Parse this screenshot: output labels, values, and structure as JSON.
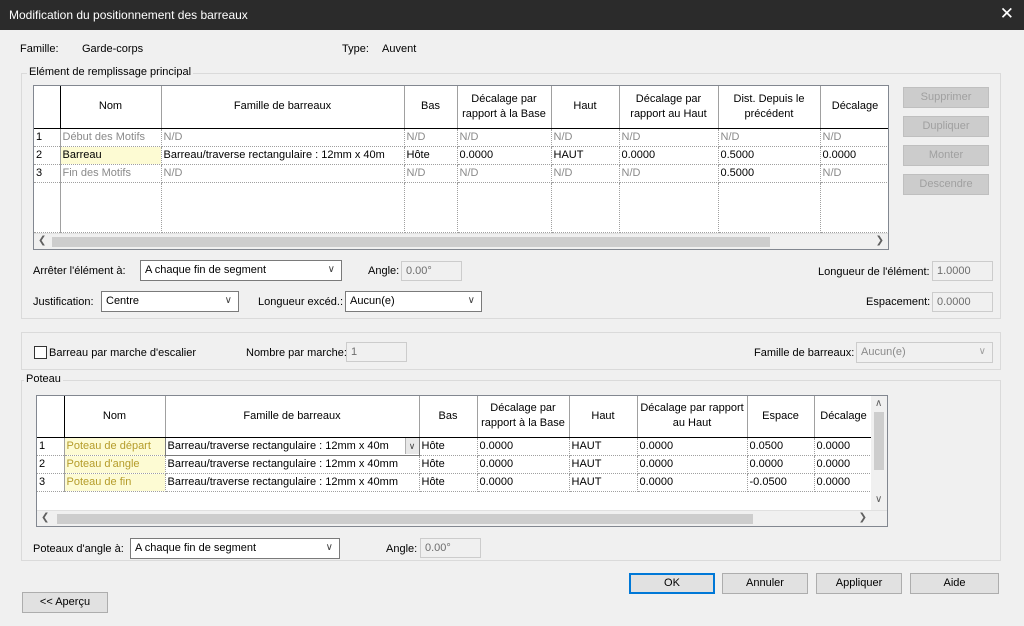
{
  "window": {
    "title": "Modification du positionnement des barreaux",
    "close": "✕"
  },
  "header": {
    "family_label": "Famille:",
    "family_value": "Garde-corps",
    "type_label": "Type:",
    "type_value": "Auvent"
  },
  "main_group": {
    "title": "Elément de remplissage principal",
    "columns": [
      "Nom",
      "Famille de barreaux",
      "Bas",
      "Décalage par rapport à la Base",
      "Haut",
      "Décalage par rapport au Haut",
      "Dist. Depuis le précédent",
      "Décalage"
    ],
    "rows": [
      {
        "num": "1",
        "cells": [
          "Début des Motifs",
          "N/D",
          "N/D",
          "N/D",
          "N/D",
          "N/D",
          "N/D",
          "N/D"
        ]
      },
      {
        "num": "2",
        "cells": [
          "Barreau",
          "Barreau/traverse rectangulaire : 12mm x 40m",
          "Hôte",
          "0.0000",
          "HAUT",
          "0.0000",
          "0.5000",
          "0.0000"
        ]
      },
      {
        "num": "3",
        "cells": [
          "Fin des Motifs",
          "N/D",
          "N/D",
          "N/D",
          "N/D",
          "N/D",
          "0.5000",
          "N/D"
        ]
      }
    ],
    "buttons": {
      "delete": "Supprimer",
      "duplicate": "Dupliquer",
      "up": "Monter",
      "down": "Descendre"
    },
    "stop_label": "Arrêter l'élément à:",
    "stop_value": "A chaque fin de segment",
    "angle_label": "Angle:",
    "angle_value": "0.00°",
    "length_label": "Longueur de l'élément:",
    "length_value": "1.0000",
    "justification_label": "Justification:",
    "justification_value": "Centre",
    "excess_label": "Longueur excéd.:",
    "excess_value": "Aucun(e)",
    "spacing_label": "Espacement:",
    "spacing_value": "0.0000"
  },
  "stair": {
    "checkbox_label": "Barreau par marche d'escalier",
    "checked": false,
    "per_step_label": "Nombre par marche:",
    "per_step_value": "1",
    "family_label": "Famille de barreaux:",
    "family_value": "Aucun(e)"
  },
  "posts": {
    "title": "Poteau",
    "columns": [
      "Nom",
      "Famille de barreaux",
      "Bas",
      "Décalage par rapport à la Base",
      "Haut",
      "Décalage par rapport au Haut",
      "Espace",
      "Décalage"
    ],
    "rows": [
      {
        "num": "1",
        "cells": [
          "Poteau de départ",
          "Barreau/traverse rectangulaire : 12mm x 40m",
          "Hôte",
          "0.0000",
          "HAUT",
          "0.0000",
          "0.0500",
          "0.0000"
        ]
      },
      {
        "num": "2",
        "cells": [
          "Poteau d'angle",
          "Barreau/traverse rectangulaire : 12mm x 40mm",
          "Hôte",
          "0.0000",
          "HAUT",
          "0.0000",
          "0.0000",
          "0.0000"
        ]
      },
      {
        "num": "3",
        "cells": [
          "Poteau de fin",
          "Barreau/traverse rectangulaire : 12mm x 40mm",
          "Hôte",
          "0.0000",
          "HAUT",
          "0.0000",
          "-0.0500",
          "0.0000"
        ]
      }
    ],
    "corner_label": "Poteaux d'angle à:",
    "corner_value": "A chaque fin de segment",
    "angle_label": "Angle:",
    "angle_value": "0.00°"
  },
  "footer": {
    "preview": "<< Aperçu",
    "ok": "OK",
    "cancel": "Annuler",
    "apply": "Appliquer",
    "help": "Aide"
  },
  "icons": {
    "chevron_down": "chevron-down-icon",
    "scroll_left": "arrow-left-icon",
    "scroll_right": "arrow-right-icon",
    "scroll_up": "arrow-up-icon",
    "scroll_down": "arrow-down-icon"
  }
}
